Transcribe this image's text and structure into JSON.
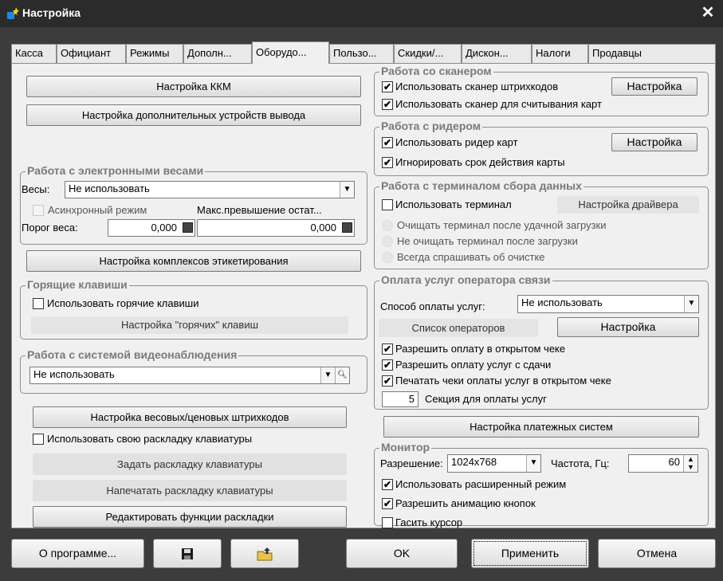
{
  "window": {
    "title": "Настройка",
    "close": "✕"
  },
  "tabs": [
    "Касса",
    "Официант",
    "Режимы",
    "Дополн...",
    "Оборудо...",
    "Пользо...",
    "Скидки/...",
    "Дискон...",
    "Налоги",
    "Продавцы"
  ],
  "left": {
    "kkm_button": "Настройка ККМ",
    "output_devices_button": "Настройка дополнительных устройств вывода",
    "scales": {
      "title": "Работа с электронными весами",
      "scales_label": "Весы:",
      "scales_value": "Не использовать",
      "async_label": "Асинхронный режим",
      "max_excess_label": "Макс.превышение остат...",
      "threshold_label": "Порог веса:",
      "threshold_value": "0,000",
      "max_excess_value": "0,000"
    },
    "labeling_button": "Настройка комплексов этикетирования",
    "hotkeys": {
      "title": "Горящие клавиши",
      "use_label": "Использовать горячие клавиши",
      "setup_button": "Настройка \"горячих\" клавиш"
    },
    "video": {
      "title": "Работа с системой видеонаблюдения",
      "value": "Не использовать"
    },
    "barcode_button": "Настройка весовых/ценовых штрихкодов",
    "own_layout_label": "Использовать свою раскладку клавиатуры",
    "set_layout_button": "Задать раскладку клавиатуры",
    "print_layout_button": "Напечатать раскладку клавиатуры",
    "edit_layout_button": "Редактировать функции раскладки"
  },
  "right": {
    "scanner": {
      "title": "Работа со сканером",
      "use_barcode_scanner": "Использовать сканер штрихкодов",
      "setup_button": "Настройка",
      "use_card_scanner": "Использовать сканер для считывания карт"
    },
    "reader": {
      "title": "Работа с ридером",
      "use_reader": "Использовать ридер карт",
      "setup_button": "Настройка",
      "ignore_expiry": "Игнорировать срок действия карты"
    },
    "terminal": {
      "title": "Работа с терминалом сбора данных",
      "use_terminal": "Использовать терминал",
      "driver_button": "Настройка драйвера",
      "radio1": "Очищать терминал после удачной загрузки",
      "radio2": "Не очищать терминал после загрузки",
      "radio3": "Всегда спрашивать об очистке"
    },
    "payment": {
      "title": "Оплата услуг оператора связи",
      "method_label": "Способ оплаты услуг:",
      "method_value": "Не использовать",
      "operators_button": "Список операторов",
      "setup_button": "Настройка",
      "allow_open": "Разрешить оплату в открытом чеке",
      "allow_change": "Разрешить оплату услуг с сдачи",
      "print_open": "Печатать чеки оплаты услуг в открытом чеке",
      "section_value": "5",
      "section_label": "Секция для оплаты услуг"
    },
    "payment_systems_button": "Настройка платежных систем",
    "monitor": {
      "title": "Монитор",
      "resolution_label": "Разрешение:",
      "resolution_value": "1024x768",
      "freq_label": "Частота, Гц:",
      "freq_value": "60",
      "extended_mode": "Использовать расширенный режим",
      "button_anim": "Разрешить анимацию кнопок",
      "hide_cursor": "Гасить курсор"
    }
  },
  "bottom": {
    "about": "О программе...",
    "ok": "OK",
    "apply": "Применить",
    "cancel": "Отмена"
  },
  "check_mark": "✔"
}
